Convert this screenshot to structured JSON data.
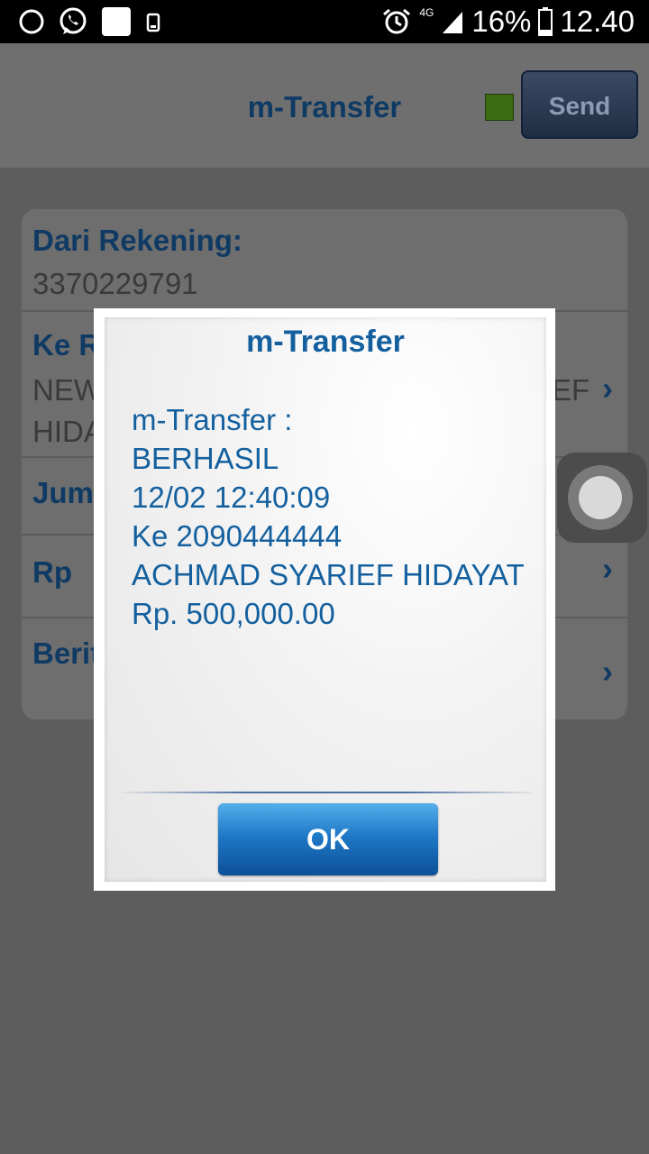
{
  "status_bar": {
    "battery": "16%",
    "time": "12.40",
    "network": "4G",
    "icons": [
      "circle-notification-icon",
      "whatsapp-icon",
      "white-square-notification-icon",
      "phone-vibrate-icon",
      "alarm-icon",
      "signal-icon",
      "battery-icon"
    ]
  },
  "header": {
    "title": "m-Transfer",
    "send_label": "Send",
    "status_color": "#3b6b12"
  },
  "form": {
    "from_label": "Dari Rekening:",
    "from_value": "3370229791",
    "to_label_visible": "Ke R",
    "to_value_line1_left": "NEW",
    "to_value_line1_right": "EF",
    "to_value_line2_left": "HIDA",
    "amount_label_visible": "Jum",
    "rp_label": "Rp",
    "message_label_visible": "Berit"
  },
  "dialog": {
    "title": "m-Transfer",
    "lines": [
      "m-Transfer :",
      "BERHASIL",
      "12/02 12:40:09",
      "Ke 2090444444",
      "ACHMAD SYARIEF HIDAYAT",
      "Rp. 500,000.00"
    ],
    "ok_label": "OK"
  },
  "colors": {
    "accent_blue": "#14609e",
    "ok_button": "#1f79c7"
  }
}
